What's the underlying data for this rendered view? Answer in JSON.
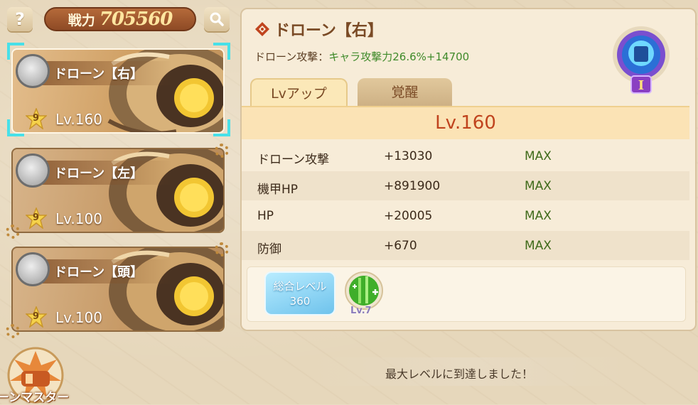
{
  "header": {
    "help_label": "?",
    "power_label": "戦力",
    "power_value": "705560"
  },
  "drones": [
    {
      "name": "ドローン【右】",
      "star": "9",
      "level": "Lv.160",
      "selected": true
    },
    {
      "name": "ドローン【左】",
      "star": "9",
      "level": "Lv.100",
      "selected": false
    },
    {
      "name": "ドローン【頭】",
      "star": "9",
      "level": "Lv.100",
      "selected": false
    }
  ],
  "master_button": {
    "label": "ーンマスター"
  },
  "detail": {
    "title": "ドローン【右】",
    "effect_label": "ドローン攻撃：",
    "effect_value": "キャラ攻撃力26.6%+14700",
    "badge_rank": "I",
    "tabs": [
      {
        "label": "Lvアップ",
        "active": true
      },
      {
        "label": "覚醒",
        "active": false
      }
    ],
    "level": "Lv.160",
    "stats": [
      {
        "name": "ドローン攻撃",
        "value": "+13030",
        "status": "MAX"
      },
      {
        "name": "機甲HP",
        "value": "+891900",
        "status": "MAX"
      },
      {
        "name": "HP",
        "value": "+20005",
        "status": "MAX"
      },
      {
        "name": "防御",
        "value": "+670",
        "status": "MAX"
      }
    ],
    "total_level_label": "総合レベル",
    "total_level_value": "360",
    "skill_level": "Lv.7",
    "max_message": "最大レベルに到達しました！"
  },
  "colors": {
    "accent_orange": "#c0441e",
    "max_green": "#3f6a1a",
    "selection_cyan": "#48e0e8",
    "power_bg": "#8e4a25"
  }
}
